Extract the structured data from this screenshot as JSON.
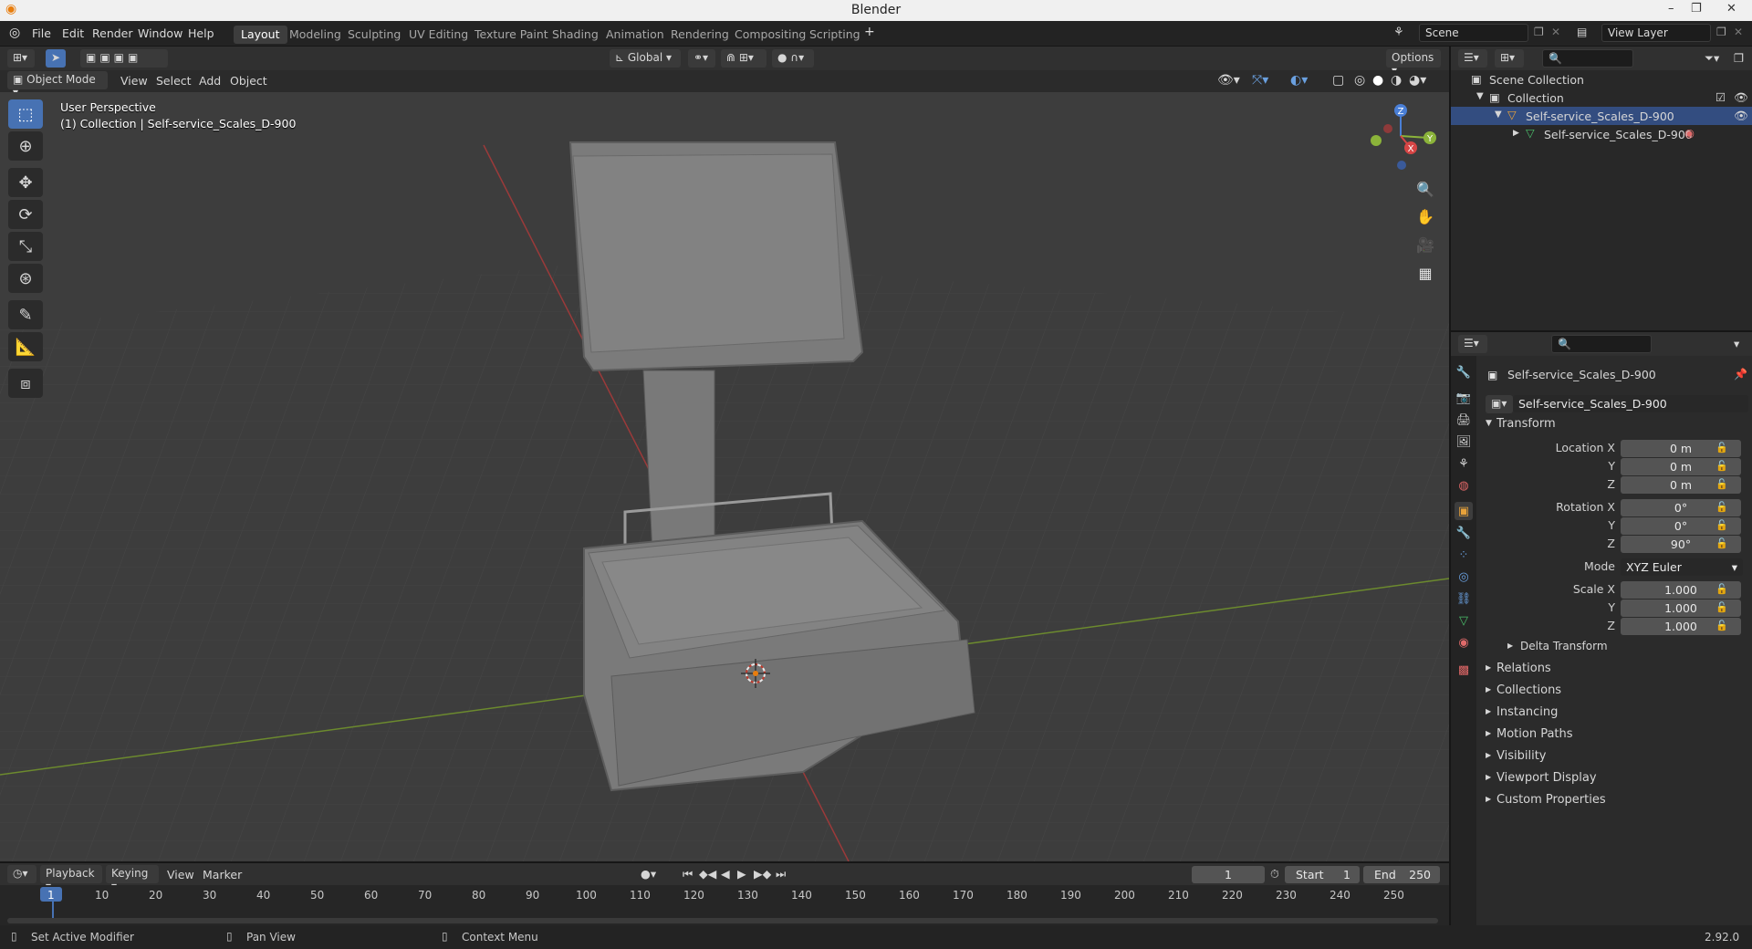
{
  "window": {
    "title": "Blender",
    "minimize": "–",
    "maximize": "❐",
    "close": "✕"
  },
  "menus": [
    "File",
    "Edit",
    "Render",
    "Window",
    "Help"
  ],
  "workspace_tabs": [
    {
      "label": "Layout",
      "active": true
    },
    {
      "label": "Modeling"
    },
    {
      "label": "Sculpting"
    },
    {
      "label": "UV Editing"
    },
    {
      "label": "Texture Paint"
    },
    {
      "label": "Shading"
    },
    {
      "label": "Animation"
    },
    {
      "label": "Rendering"
    },
    {
      "label": "Compositing"
    },
    {
      "label": "Scripting"
    }
  ],
  "add_workspace": "+",
  "scene": {
    "name": "Scene",
    "view_layer": "View Layer"
  },
  "viewport_header": {
    "transform_orientation": "Global",
    "options": "Options",
    "mode": "Object Mode",
    "menus": [
      "View",
      "Select",
      "Add",
      "Object"
    ]
  },
  "viewport": {
    "perspective": "User Perspective",
    "collection_info": "(1) Collection | Self-service_Scales_D-900",
    "gizmo": {
      "x": "X",
      "y": "Y",
      "z": "Z"
    }
  },
  "outliner": {
    "scene_collection": "Scene Collection",
    "collection": "Collection",
    "object": "Self-service_Scales_D-900",
    "mesh": "Self-service_Scales_D-900"
  },
  "properties": {
    "object_name": "Self-service_Scales_D-900",
    "datablock": "Self-service_Scales_D-900",
    "transform_title": "Transform",
    "location": {
      "label_x": "Location X",
      "x": "0 m",
      "y": "0 m",
      "z": "0 m"
    },
    "rotation": {
      "label_x": "Rotation X",
      "x": "0°",
      "y": "0°",
      "z": "90°"
    },
    "axis_labels": {
      "y": "Y",
      "z": "Z"
    },
    "mode_label": "Mode",
    "mode_value": "XYZ Euler",
    "scale": {
      "label_x": "Scale X",
      "x": "1.000",
      "y": "1.000",
      "z": "1.000"
    },
    "delta_transform": "Delta Transform",
    "sections": [
      "Relations",
      "Collections",
      "Instancing",
      "Motion Paths",
      "Visibility",
      "Viewport Display",
      "Custom Properties"
    ]
  },
  "timeline": {
    "menus": [
      "Playback",
      "Keying",
      "View",
      "Marker"
    ],
    "current_frame": "1",
    "start_label": "Start",
    "start": "1",
    "end_label": "End",
    "end": "250",
    "ticks": [
      "1",
      "10",
      "20",
      "30",
      "40",
      "50",
      "60",
      "70",
      "80",
      "90",
      "100",
      "110",
      "120",
      "130",
      "140",
      "150",
      "160",
      "170",
      "180",
      "190",
      "200",
      "210",
      "220",
      "230",
      "240",
      "250"
    ]
  },
  "statusbar": {
    "left": "Set Active Modifier",
    "middle": "Pan View",
    "right": "Context Menu",
    "version": "2.92.0"
  }
}
